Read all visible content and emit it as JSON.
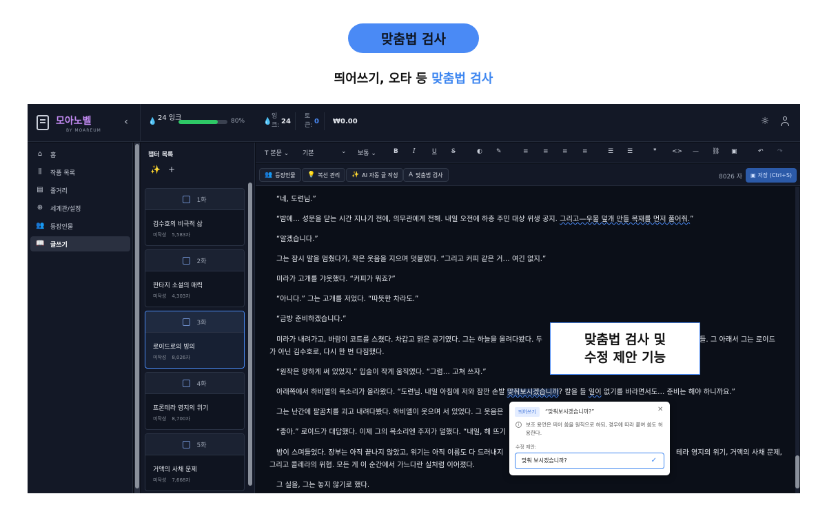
{
  "hero": {
    "pill_label": "맞춤법 검사",
    "subtitle_prefix": "띄어쓰기, 오타 등 ",
    "subtitle_accent": "맞춤법 검사"
  },
  "callout": {
    "line1": "맞춤법 검사 및",
    "line2": "수정 제안 기능"
  },
  "topbar": {
    "logo_name": "모아노벨",
    "logo_by": "BY MOAREUM",
    "ink_value": "24 잉크",
    "progress_fraction": 0.8,
    "progress_label": "80%",
    "ink_small_label": "잉크:",
    "ink_small_value": "24",
    "token_label": "토큰:",
    "token_value": "0",
    "money": "₩0.00"
  },
  "sidebar": {
    "items": [
      {
        "label": "홈",
        "icon": "home-icon"
      },
      {
        "label": "작품 목록",
        "icon": "library-icon"
      },
      {
        "label": "줄거리",
        "icon": "scroll-icon"
      },
      {
        "label": "세계관/설정",
        "icon": "globe-icon"
      },
      {
        "label": "등장인물",
        "icon": "people-icon"
      },
      {
        "label": "글쓰기",
        "icon": "book-open-icon"
      }
    ]
  },
  "chapters": {
    "title": "챕터 목록",
    "items": [
      {
        "num": "1화",
        "title": "김수호의 비극적 삶",
        "status": "미작성",
        "count": "5,583자"
      },
      {
        "num": "2화",
        "title": "판타지 소설의 매력",
        "status": "미작성",
        "count": "4,303자"
      },
      {
        "num": "3화",
        "title": "로이드로의 빙의",
        "status": "미작성",
        "count": "8,026자"
      },
      {
        "num": "4화",
        "title": "프론테라 영지의 위기",
        "status": "미작성",
        "count": "8,700자"
      },
      {
        "num": "5화",
        "title": "거액의 사채 문제",
        "status": "미작성",
        "count": "7,668자"
      }
    ]
  },
  "toolbar": {
    "text_style": "본문",
    "font": "기본",
    "size": "보통",
    "bold": "B",
    "italic": "I",
    "underline": "U",
    "strike": "S"
  },
  "actions": {
    "characters": "등장인물",
    "foreshadow": "복선 관리",
    "ai_write": "AI 자동 글 작성",
    "spellcheck": "맞춤법 검사",
    "char_count": "8026 자",
    "save": "저장 (Ctrl+S)"
  },
  "editor": {
    "p1": "“네, 도련님.”",
    "p2_a": "“밤에… 성문을 닫는 시간 지나기 전에, 의무관에게 전해. 내일 오전에 하층 주민 대상 위생 공지. ",
    "p2_b": "그리고—우물 덮개 만들 목재를 먼저 풀어줘.",
    "p2_c": "”",
    "p3": "“알겠습니다.”",
    "p4": "그는 잠시 말을 멈췄다가, 작은 웃음을 지으며 덧붙였다. “그리고 커피 같은 거… 여긴 없지.”",
    "p5": "미라가 고개를 갸웃했다. “커피가 뭐죠?”",
    "p6": "“아니다.” 그는 고개를 저었다. “따뜻한 차라도.”",
    "p7": "“금방 준비하겠습니다.”",
    "p8_a": "미라가 내려가고, 바람이 코트를 스쳤다. 차갑고 맑은 공기였다. 그는 하늘을 올려다봤다. 두",
    "p8_b": "들. 그 아래서 그는 로이드",
    "p8_c": "가 아닌 김수호로, 다시 한 번 다짐했다.",
    "p9": "“원작은 망하게 써 있었지.” 입술이 작게 움직였다. “그럼… 고쳐 쓰자.”",
    "p10_a": "아래쪽에서 하비엘의 목소리가 올라왔다. “도련님. 내일 아침에 저와 잠깐 손발 ",
    "p10_b": "맞춰보시겠습니까",
    "p10_c": "? 칼을 들 ",
    "p10_d": "일이",
    "p10_e": " 없기를 바라면서도… 준비는 해야 하니까요.”",
    "p11": "그는 난간에 팔꿈치를 괴고 내려다봤다. 하비엘이 웃으며 서 있었다. 그 웃음은",
    "p12": "“좋아.” 로이드가 대답했다. 이제 그의 목소리엔 주저가 덜했다. “내일, 해 뜨기",
    "p13_a": "밤이 스며들었다. 장부는 아직 끝나지 않았고, 위기는 아직 이름도 다 드러내지",
    "p13_b": "테라 영지의 위기, 거액의 사채 문제,",
    "p13_c": "그리고 콜레라의 위협. 모든 게 이 순간에서 가느다란 실처럼 이어졌다.",
    "p14": "그 실을, 그는 놓지 않기로 했다."
  },
  "popover": {
    "tag": "띄어쓰기",
    "word": "“맞춰보시겠습니까?”",
    "desc": "보조 용언은 띄어 씀을 원칙으로 하되, 경우에 따라 붙여 씀도 허용한다.",
    "label": "수정 제안:",
    "suggestion": "맞춰 보시겠습니까?"
  },
  "colors": {
    "accent": "#4a8af5",
    "progress": "#2ec866",
    "background": "#0b0f18"
  }
}
